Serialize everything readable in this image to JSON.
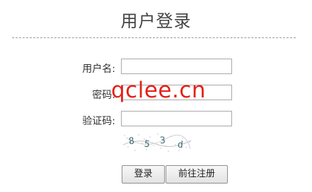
{
  "page": {
    "title": "用户登录"
  },
  "form": {
    "username_label": "用户名:",
    "username_value": "",
    "password_label": "密码:",
    "password_value": "",
    "captcha_label": "验证码:",
    "captcha_value": "",
    "captcha_text": [
      "8",
      "5",
      "3",
      "d"
    ]
  },
  "buttons": {
    "login": "登录",
    "register": "前往注册"
  },
  "watermark": {
    "text": "qclee.cn",
    "color": "#e2231a"
  }
}
